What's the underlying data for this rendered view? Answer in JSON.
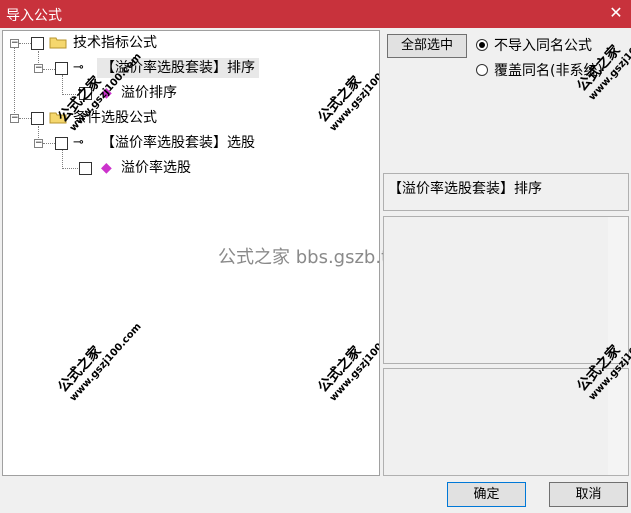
{
  "window": {
    "title": "导入公式"
  },
  "tree": {
    "root1": {
      "label": "技术指标公式"
    },
    "child1": {
      "label": "【溢价率选股套装】排序"
    },
    "leaf1": {
      "label": "溢价排序"
    },
    "root2": {
      "label": "条件选股公式"
    },
    "child2": {
      "label": "【溢价率选股套装】选股"
    },
    "leaf2": {
      "label": "溢价率选股"
    }
  },
  "controls": {
    "select_all": "全部选中",
    "radio_skip": "不导入同名公式",
    "radio_overwrite": "覆盖同名(非系统)",
    "selected_formula": "【溢价率选股套装】排序",
    "ok": "确定",
    "cancel": "取消"
  },
  "watermark": {
    "center": "公式之家 bbs.gszb.top",
    "stamp": "公式之家",
    "url": "www.gszj100.com"
  },
  "colors": {
    "titlebar": "#c8323c",
    "leaf_icon": "#cc33cc"
  }
}
